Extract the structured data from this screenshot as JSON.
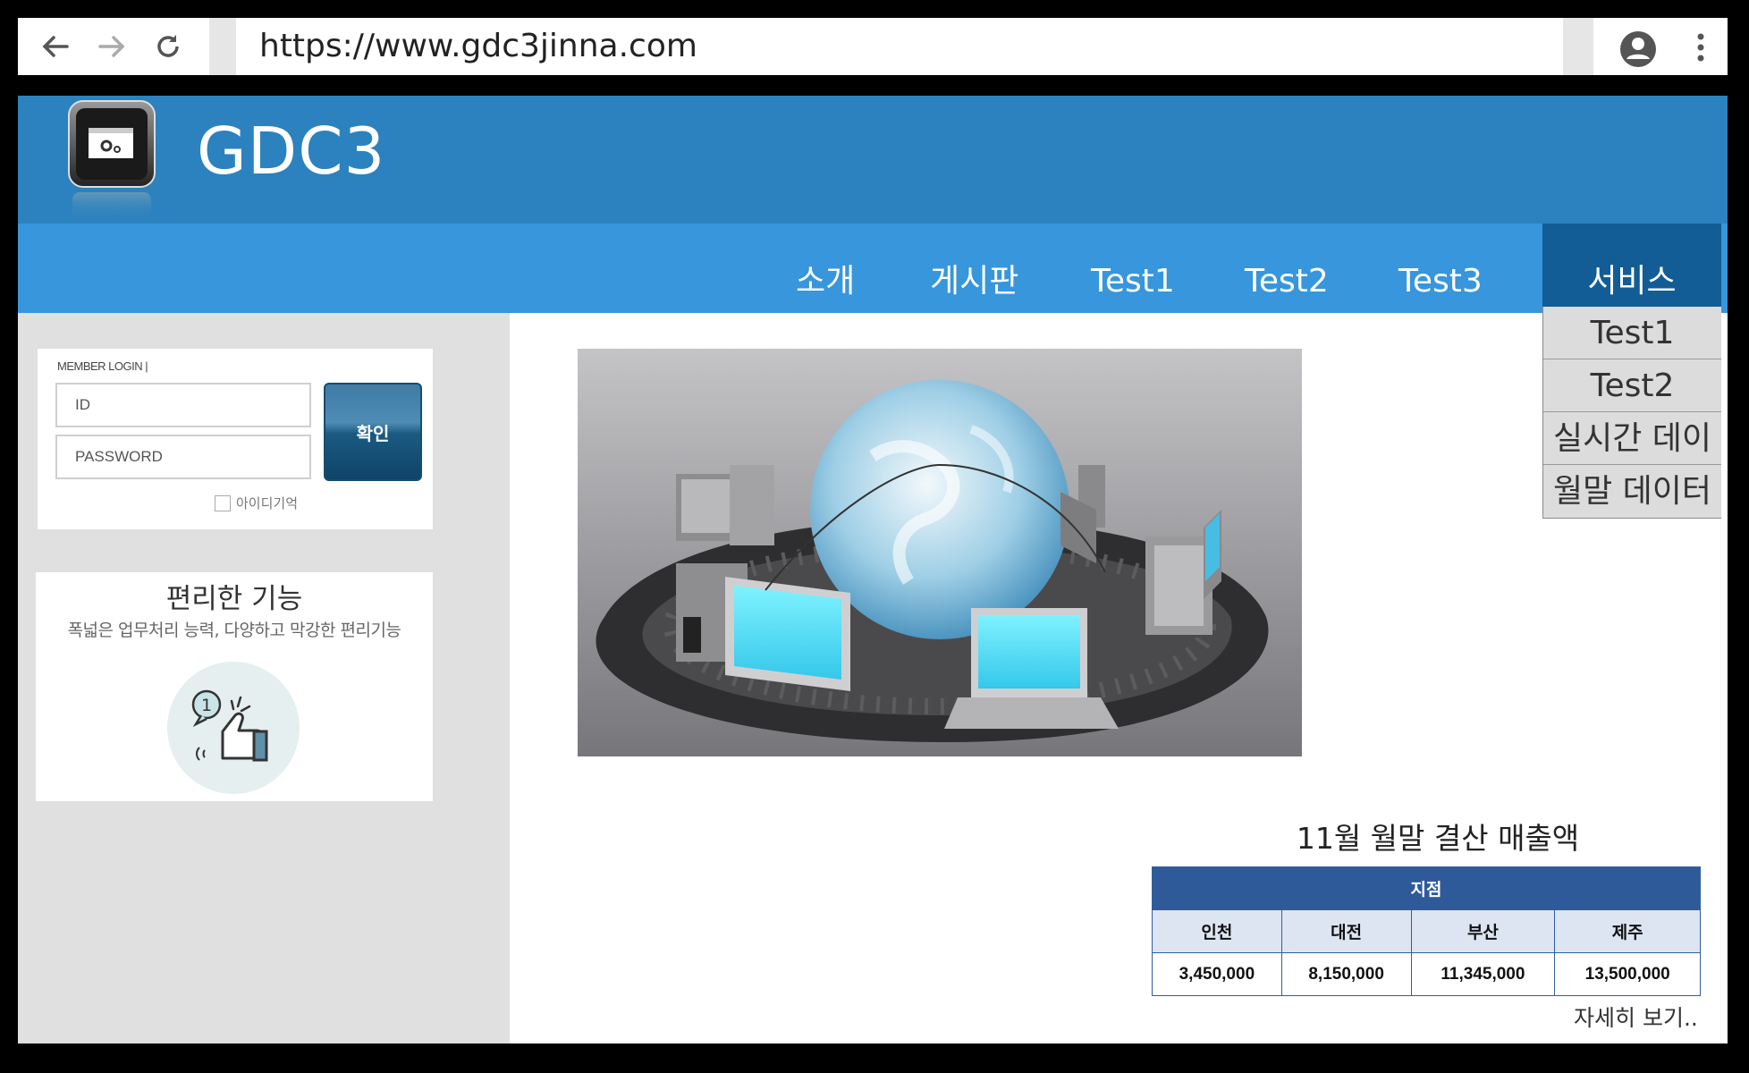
{
  "browser": {
    "url": "https://www.gdc3jinna.com",
    "back_icon": "back-arrow-icon",
    "forward_icon": "forward-arrow-icon",
    "reload_icon": "reload-icon",
    "account_icon": "account-icon",
    "menu_icon": "vertical-dots-icon"
  },
  "header": {
    "site_title": "GDC3",
    "logo_icon": "app-window-gear-icon",
    "color": "#2c82be"
  },
  "nav": {
    "color": "#3796dc",
    "active_color": "#125d96",
    "items": [
      {
        "label": "소개"
      },
      {
        "label": "게시판"
      },
      {
        "label": "Test1"
      },
      {
        "label": "Test2"
      },
      {
        "label": "Test3"
      },
      {
        "label": "서비스",
        "active": true
      }
    ],
    "dropdown": [
      {
        "label": "Test1"
      },
      {
        "label": "Test2"
      },
      {
        "label": "실시간 데이"
      },
      {
        "label": "월말 데이터"
      }
    ]
  },
  "login": {
    "title": "MEMBER LOGIN |",
    "id_placeholder": "ID",
    "password_placeholder": "PASSWORD",
    "submit_label": "확인",
    "remember_label": "아이디기억"
  },
  "feature": {
    "title": "편리한 기능",
    "description": "폭넓은 업무처리 능력, 다양하고 막강한 편리기능",
    "icon": "thumbs-up-icon",
    "icon_badge": "1"
  },
  "hero": {
    "icon": "globe-network-computers-image"
  },
  "sales": {
    "title": "11월 월말 결산 매출액",
    "group_header": "지점",
    "columns": [
      "인천",
      "대전",
      "부산",
      "제주"
    ],
    "values": [
      "3,450,000",
      "8,150,000",
      "11,345,000",
      "13,500,000"
    ],
    "more_label": "자세히 보기.."
  }
}
